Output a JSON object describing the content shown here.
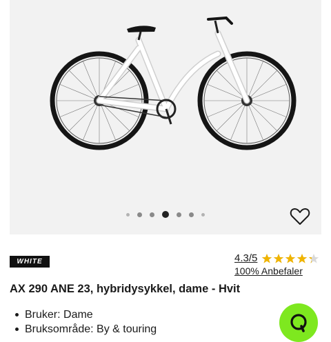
{
  "gallery": {
    "dot_count": 7,
    "active_index": 3,
    "product_image": "white-hybrid-bicycle"
  },
  "favorite": {
    "icon": "heart-outline-icon"
  },
  "brand": {
    "logo_text": "WHITE"
  },
  "rating": {
    "value": "4.3/5",
    "stars": 4.3,
    "star_color": "#f0b400",
    "recommend": "100% Anbefaler"
  },
  "product": {
    "title": "AX 290 ANE 23, hybridysykkel, dame - Hvit",
    "features": [
      "Bruker: Dame",
      "Bruksområde: By & touring"
    ]
  },
  "search_fab": {
    "icon": "search-icon",
    "color": "#7ee81f"
  }
}
